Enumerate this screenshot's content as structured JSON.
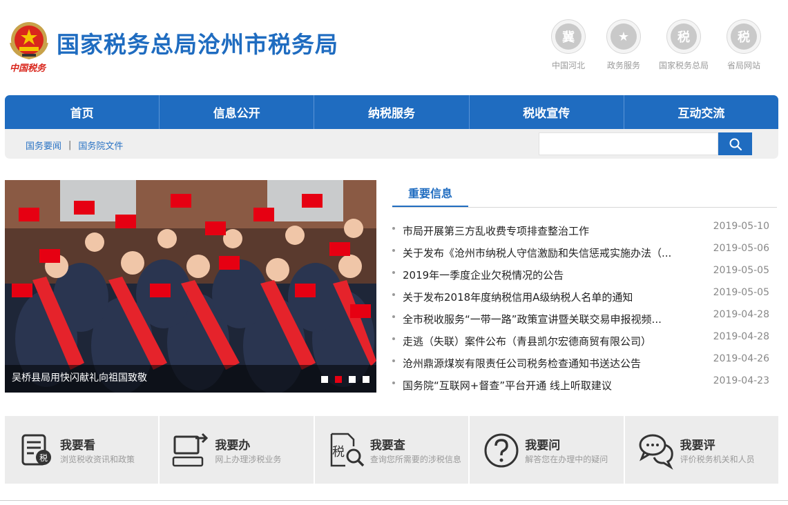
{
  "header": {
    "emblem_text": "中国税务",
    "title": "国家税务总局沧州市税务局",
    "quick_links": [
      {
        "label": "中国河北",
        "icon": "hebei-seal-icon",
        "glyph": "冀"
      },
      {
        "label": "政务服务",
        "icon": "star-shield-icon",
        "glyph": "★"
      },
      {
        "label": "国家税务总局",
        "icon": "tax-bureau-icon",
        "glyph": "税"
      },
      {
        "label": "省局网站",
        "icon": "province-tax-icon",
        "glyph": "税"
      }
    ]
  },
  "nav": {
    "items": [
      "首页",
      "信息公开",
      "纳税服务",
      "税收宣传",
      "互动交流"
    ]
  },
  "subbar": {
    "links": [
      "国务要闻",
      "国务院文件"
    ],
    "separator": "|",
    "search_placeholder": ""
  },
  "slideshow": {
    "caption": "吴桥县局用快闪献礼向祖国致敬",
    "slide_count": 4,
    "active_index": 1
  },
  "news": {
    "tab_label": "重要信息",
    "items": [
      {
        "title": "市局开展第三方乱收费专项排查整治工作",
        "date": "2019-05-10"
      },
      {
        "title": "关于发布《沧州市纳税人守信激励和失信惩戒实施办法（...",
        "date": "2019-05-06"
      },
      {
        "title": "2019年一季度企业欠税情况的公告",
        "date": "2019-05-05"
      },
      {
        "title": "关于发布2018年度纳税信用A级纳税人名单的通知",
        "date": "2019-05-05"
      },
      {
        "title": "全市税收服务“一带一路”政策宣讲暨关联交易申报视频...",
        "date": "2019-04-28"
      },
      {
        "title": "走逃（失联）案件公布（青县凯尔宏德商贸有限公司）",
        "date": "2019-04-28"
      },
      {
        "title": "沧州鼎源煤炭有限责任公司税务检查通知书送达公告",
        "date": "2019-04-26"
      },
      {
        "title": "国务院“互联网+督查”平台开通 线上听取建议",
        "date": "2019-04-23"
      }
    ]
  },
  "services": [
    {
      "name": "我要看",
      "desc": "浏览税收资讯和政策",
      "icon": "document-tax-icon"
    },
    {
      "name": "我要办",
      "desc": "网上办理涉税业务",
      "icon": "computer-transfer-icon"
    },
    {
      "name": "我要查",
      "desc": "查询您所需要的涉税信息",
      "icon": "tax-search-icon"
    },
    {
      "name": "我要问",
      "desc": "解答您在办理中的疑问",
      "icon": "question-icon"
    },
    {
      "name": "我要评",
      "desc": "评价税务机关和人员",
      "icon": "chat-bubbles-icon"
    }
  ],
  "colors": {
    "brand_blue": "#1f6cc0",
    "accent_red": "#e60012",
    "service_bg": "#ececec"
  }
}
